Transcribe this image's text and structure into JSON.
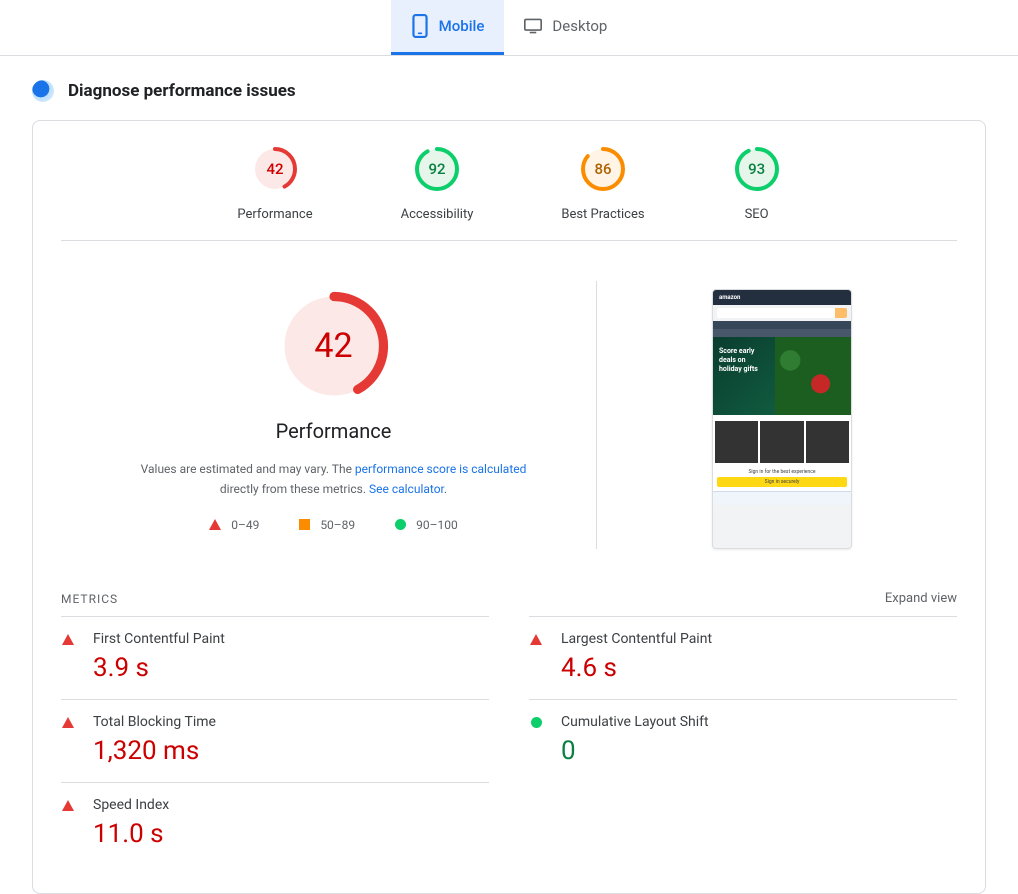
{
  "tabs": [
    {
      "id": "mobile",
      "label": "Mobile",
      "active": true
    },
    {
      "id": "desktop",
      "label": "Desktop",
      "active": false
    }
  ],
  "diagnose_title": "Diagnose performance issues",
  "scores": [
    {
      "label": "Performance",
      "value": 42,
      "status": "red"
    },
    {
      "label": "Accessibility",
      "value": 92,
      "status": "green"
    },
    {
      "label": "Best Practices",
      "value": 86,
      "status": "orange"
    },
    {
      "label": "SEO",
      "value": 93,
      "status": "green"
    }
  ],
  "hero": {
    "score": 42,
    "title": "Performance",
    "desc_prefix": "Values are estimated and may vary. The ",
    "desc_link1": "performance score is calculated",
    "desc_mid": " directly from these metrics. ",
    "desc_link2": "See calculator",
    "desc_suffix": "."
  },
  "legend": [
    {
      "shape": "tri",
      "label": "0–49"
    },
    {
      "shape": "sq",
      "label": "50–89"
    },
    {
      "shape": "cir",
      "label": "90–100"
    }
  ],
  "screenshot": {
    "brand": "amazon",
    "banner_line1": "Score early",
    "banner_line2": "deals on",
    "banner_line3": "holiday gifts",
    "signin_head": "Sign in for the best experience",
    "signin_btn": "Sign in securely"
  },
  "metrics_section": {
    "title": "METRICS",
    "expand": "Expand view"
  },
  "metrics": [
    {
      "name": "First Contentful Paint",
      "value": "3.9 s",
      "status": "red",
      "col": 0
    },
    {
      "name": "Largest Contentful Paint",
      "value": "4.6 s",
      "status": "red",
      "col": 1
    },
    {
      "name": "Total Blocking Time",
      "value": "1,320 ms",
      "status": "red",
      "col": 0
    },
    {
      "name": "Cumulative Layout Shift",
      "value": "0",
      "status": "green",
      "col": 1
    },
    {
      "name": "Speed Index",
      "value": "11.0 s",
      "status": "red",
      "col": 0
    }
  ],
  "colors": {
    "red": "#e53935",
    "orange": "#fb8c00",
    "green": "#0cce6b",
    "red_fill": "#fce8e6",
    "orange_fill": "#fff4e5",
    "green_fill": "#e6f6ea"
  }
}
